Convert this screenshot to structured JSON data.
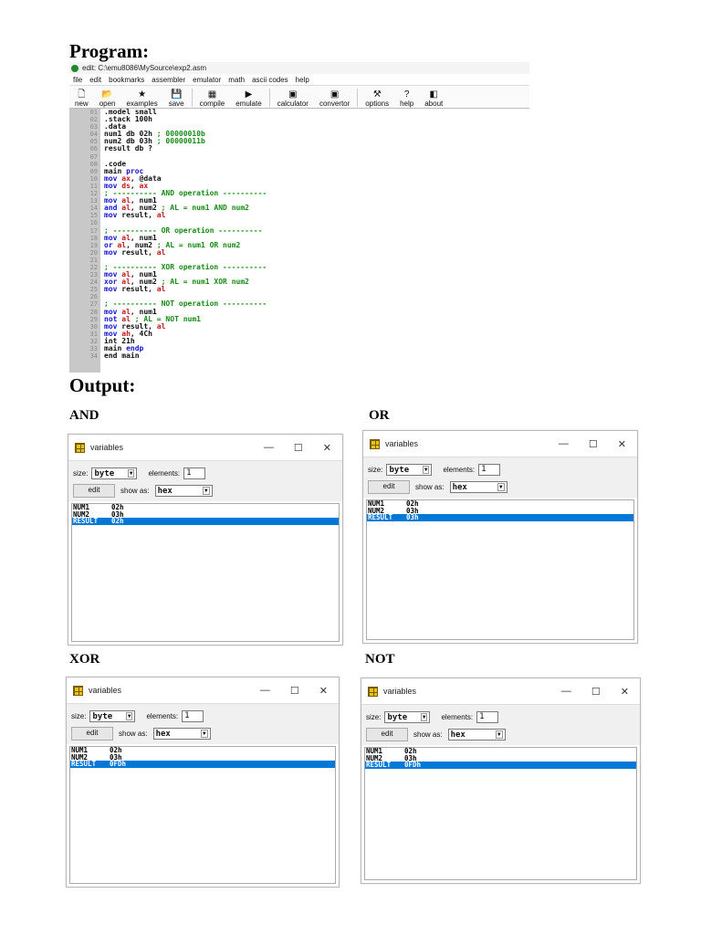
{
  "headings": {
    "program": "Program:",
    "output": "Output:"
  },
  "editor": {
    "title": "edit: C:\\emu8086\\MySource\\exp2.asm",
    "menu": [
      "file",
      "edit",
      "bookmarks",
      "assembler",
      "emulator",
      "math",
      "ascii codes",
      "help"
    ],
    "toolbar": [
      {
        "label": "new",
        "icon": "new-file-icon",
        "glyph": "🗋"
      },
      {
        "label": "open",
        "icon": "open-folder-icon",
        "glyph": "📂"
      },
      {
        "label": "examples",
        "icon": "star-icon",
        "glyph": "★"
      },
      {
        "label": "save",
        "icon": "floppy-disk-icon",
        "glyph": "💾"
      },
      {
        "label": "compile",
        "icon": "compile-icon",
        "glyph": "▦"
      },
      {
        "label": "emulate",
        "icon": "play-icon",
        "glyph": "▶"
      },
      {
        "label": "calculator",
        "icon": "calculator-icon",
        "glyph": "▣"
      },
      {
        "label": "convertor",
        "icon": "convertor-icon",
        "glyph": "▣"
      },
      {
        "label": "options",
        "icon": "tools-icon",
        "glyph": "⚒"
      },
      {
        "label": "help",
        "icon": "help-icon",
        "glyph": "?"
      },
      {
        "label": "about",
        "icon": "about-icon",
        "glyph": "◧"
      }
    ],
    "lines": [
      [
        {
          "t": ".model small",
          "c": "#111"
        }
      ],
      [
        {
          "t": ".stack 100h",
          "c": "#111"
        }
      ],
      [
        {
          "t": ".data",
          "c": "#111"
        }
      ],
      [
        {
          "t": "num1 db 02h ",
          "c": "#111"
        },
        {
          "t": "; 00000010b",
          "c": "#168a16"
        }
      ],
      [
        {
          "t": "num2 db 03h ",
          "c": "#111"
        },
        {
          "t": "; 00000011b",
          "c": "#168a16"
        }
      ],
      [
        {
          "t": "result db ?",
          "c": "#111"
        }
      ],
      [],
      [
        {
          "t": ".code",
          "c": "#111"
        }
      ],
      [
        {
          "t": "main ",
          "c": "#111"
        },
        {
          "t": "proc",
          "c": "#1414d4"
        }
      ],
      [
        {
          "t": "mov ",
          "c": "#1414d4"
        },
        {
          "t": "ax",
          "c": "#c01818"
        },
        {
          "t": ", @data",
          "c": "#111"
        }
      ],
      [
        {
          "t": "mov ",
          "c": "#1414d4"
        },
        {
          "t": "ds",
          "c": "#c01818"
        },
        {
          "t": ", ",
          "c": "#111"
        },
        {
          "t": "ax",
          "c": "#c01818"
        }
      ],
      [
        {
          "t": "; ---------- AND operation ----------",
          "c": "#168a16"
        }
      ],
      [
        {
          "t": "mov ",
          "c": "#1414d4"
        },
        {
          "t": "al",
          "c": "#c01818"
        },
        {
          "t": ", num1",
          "c": "#111"
        }
      ],
      [
        {
          "t": "and ",
          "c": "#1414d4"
        },
        {
          "t": "al",
          "c": "#c01818"
        },
        {
          "t": ", num2 ",
          "c": "#111"
        },
        {
          "t": "; AL = num1 AND num2",
          "c": "#168a16"
        }
      ],
      [
        {
          "t": "mov ",
          "c": "#1414d4"
        },
        {
          "t": "result, ",
          "c": "#111"
        },
        {
          "t": "al",
          "c": "#c01818"
        }
      ],
      [],
      [
        {
          "t": "; ---------- OR operation ----------",
          "c": "#168a16"
        }
      ],
      [
        {
          "t": "mov ",
          "c": "#1414d4"
        },
        {
          "t": "al",
          "c": "#c01818"
        },
        {
          "t": ", num1",
          "c": "#111"
        }
      ],
      [
        {
          "t": "or ",
          "c": "#1414d4"
        },
        {
          "t": "al",
          "c": "#c01818"
        },
        {
          "t": ", num2 ",
          "c": "#111"
        },
        {
          "t": "; AL = num1 OR num2",
          "c": "#168a16"
        }
      ],
      [
        {
          "t": "mov ",
          "c": "#1414d4"
        },
        {
          "t": "result, ",
          "c": "#111"
        },
        {
          "t": "al",
          "c": "#c01818"
        }
      ],
      [],
      [
        {
          "t": "; ---------- XOR operation ----------",
          "c": "#168a16"
        }
      ],
      [
        {
          "t": "mov ",
          "c": "#1414d4"
        },
        {
          "t": "al",
          "c": "#c01818"
        },
        {
          "t": ", num1",
          "c": "#111"
        }
      ],
      [
        {
          "t": "xor ",
          "c": "#1414d4"
        },
        {
          "t": "al",
          "c": "#c01818"
        },
        {
          "t": ", num2 ",
          "c": "#111"
        },
        {
          "t": "; AL = num1 XOR num2",
          "c": "#168a16"
        }
      ],
      [
        {
          "t": "mov ",
          "c": "#1414d4"
        },
        {
          "t": "result, ",
          "c": "#111"
        },
        {
          "t": "al",
          "c": "#c01818"
        }
      ],
      [],
      [
        {
          "t": "; ---------- NOT operation ----------",
          "c": "#168a16"
        }
      ],
      [
        {
          "t": "mov ",
          "c": "#1414d4"
        },
        {
          "t": "al",
          "c": "#c01818"
        },
        {
          "t": ", num1",
          "c": "#111"
        }
      ],
      [
        {
          "t": "not ",
          "c": "#1414d4"
        },
        {
          "t": "al ",
          "c": "#c01818"
        },
        {
          "t": "; AL = NOT num1",
          "c": "#168a16"
        }
      ],
      [
        {
          "t": "mov ",
          "c": "#1414d4"
        },
        {
          "t": "result, ",
          "c": "#111"
        },
        {
          "t": "al",
          "c": "#c01818"
        }
      ],
      [
        {
          "t": "mov ",
          "c": "#1414d4"
        },
        {
          "t": "ah",
          "c": "#c01818"
        },
        {
          "t": ", 4Ch",
          "c": "#111"
        }
      ],
      [
        {
          "t": "int 21h",
          "c": "#111"
        }
      ],
      [
        {
          "t": "main ",
          "c": "#111"
        },
        {
          "t": "endp",
          "c": "#1414d4"
        }
      ],
      [
        {
          "t": "end main",
          "c": "#111"
        }
      ]
    ]
  },
  "outputs": [
    {
      "label": "AND",
      "rows": [
        [
          "NUM1",
          "02h"
        ],
        [
          "NUM2",
          "03h"
        ],
        [
          "RESULT",
          "02h"
        ]
      ]
    },
    {
      "label": "OR",
      "rows": [
        [
          "NUM1",
          "02h"
        ],
        [
          "NUM2",
          "03h"
        ],
        [
          "RESULT",
          "03h"
        ]
      ]
    },
    {
      "label": "XOR",
      "rows": [
        [
          "NUM1",
          "02h"
        ],
        [
          "NUM2",
          "03h"
        ],
        [
          "RESULT",
          "0FDh"
        ]
      ]
    },
    {
      "label": "NOT",
      "rows": [
        [
          "NUM1",
          "02h"
        ],
        [
          "NUM2",
          "03h"
        ],
        [
          "RESULT",
          "0FDh"
        ]
      ]
    }
  ],
  "variables_window": {
    "title": "variables",
    "size_label": "size:",
    "size_value": "byte",
    "elements_label": "elements:",
    "elements_value": "1",
    "edit_label": "edit",
    "show_as_label": "show as:",
    "show_as_value": "hex",
    "selected_color": "#0078d7"
  }
}
